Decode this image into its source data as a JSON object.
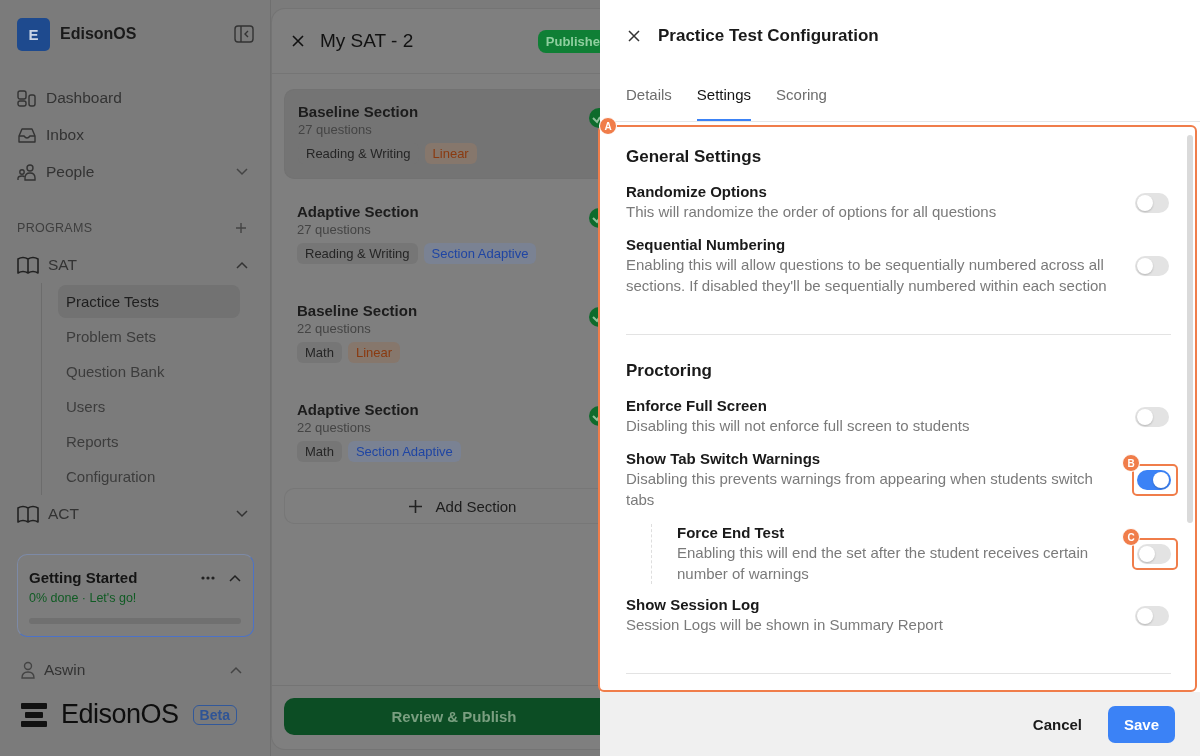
{
  "sidebar": {
    "brand": {
      "initial": "E",
      "name": "EdisonOS"
    },
    "nav": [
      {
        "label": "Dashboard"
      },
      {
        "label": "Inbox"
      },
      {
        "label": "People",
        "expanded": false
      }
    ],
    "programs_label": "PROGRAMS",
    "programs": [
      {
        "label": "SAT",
        "expanded": true,
        "children": [
          {
            "label": "Practice Tests",
            "selected": true
          },
          {
            "label": "Problem Sets",
            "selected": false
          },
          {
            "label": "Question Bank",
            "selected": false
          },
          {
            "label": "Users",
            "selected": false
          },
          {
            "label": "Reports",
            "selected": false
          },
          {
            "label": "Configuration",
            "selected": false
          }
        ]
      },
      {
        "label": "ACT",
        "expanded": false
      }
    ],
    "getting_started": {
      "title": "Getting Started",
      "progress_text": "0% done · Let's go!",
      "level": 0
    },
    "user": {
      "name": "Aswin",
      "expanded": true
    },
    "footer_logo": {
      "name": "EdisonOS",
      "badge": "Beta"
    }
  },
  "test": {
    "title": "My SAT - 2",
    "status": "Publishe",
    "sections": [
      {
        "title": "Baseline Section",
        "count": "27 questions",
        "selected": true,
        "tags": [
          {
            "label": "Reading & Writing",
            "kind": "subject"
          },
          {
            "label": "Linear",
            "kind": "linear"
          }
        ]
      },
      {
        "title": "Adaptive Section",
        "count": "27 questions",
        "selected": false,
        "tags": [
          {
            "label": "Reading & Writing",
            "kind": "subject"
          },
          {
            "label": "Section Adaptive",
            "kind": "adaptive"
          }
        ]
      },
      {
        "title": "Baseline Section",
        "count": "22 questions",
        "selected": false,
        "tags": [
          {
            "label": "Math",
            "kind": "subject"
          },
          {
            "label": "Linear",
            "kind": "linear"
          }
        ]
      },
      {
        "title": "Adaptive Section",
        "count": "22 questions",
        "selected": false,
        "tags": [
          {
            "label": "Math",
            "kind": "subject"
          },
          {
            "label": "Section Adaptive",
            "kind": "adaptive"
          }
        ]
      }
    ],
    "add_button": "Add Section",
    "publish_button": "Review & Publish"
  },
  "drawer": {
    "title": "Practice Test Configuration",
    "tabs": [
      {
        "label": "Details",
        "selected": false
      },
      {
        "label": "Settings",
        "selected": true
      },
      {
        "label": "Scoring",
        "selected": false
      }
    ],
    "marker": "A",
    "sections": [
      {
        "title": "General Settings",
        "items": [
          {
            "label": "Randomize Options",
            "description": "This will randomize the order of options for all questions",
            "on": false
          },
          {
            "label": "Sequential Numbering",
            "description": "Enabling this will allow questions to be sequentially numbered across all sections. If disabled they'll be sequentially numbered within each section",
            "on": false
          }
        ]
      },
      {
        "title": "Proctoring",
        "items": [
          {
            "label": "Enforce Full Screen",
            "description": "Disabling this will not enforce full screen to students",
            "on": false
          },
          {
            "label": "Show Tab Switch Warnings",
            "description": "Disabling this prevents warnings from appearing when students switch tabs",
            "on": true,
            "marker": "B",
            "children": [
              {
                "label": "Force End Test",
                "description": "Enabling this will end the set after the student receives certain number of warnings",
                "on": false,
                "marker": "C"
              }
            ]
          },
          {
            "label": "Show Session Log",
            "description": "Session Logs will be shown in Summary Report",
            "on": false
          }
        ]
      }
    ],
    "cancel_button": "Cancel",
    "save_button": "Save"
  }
}
